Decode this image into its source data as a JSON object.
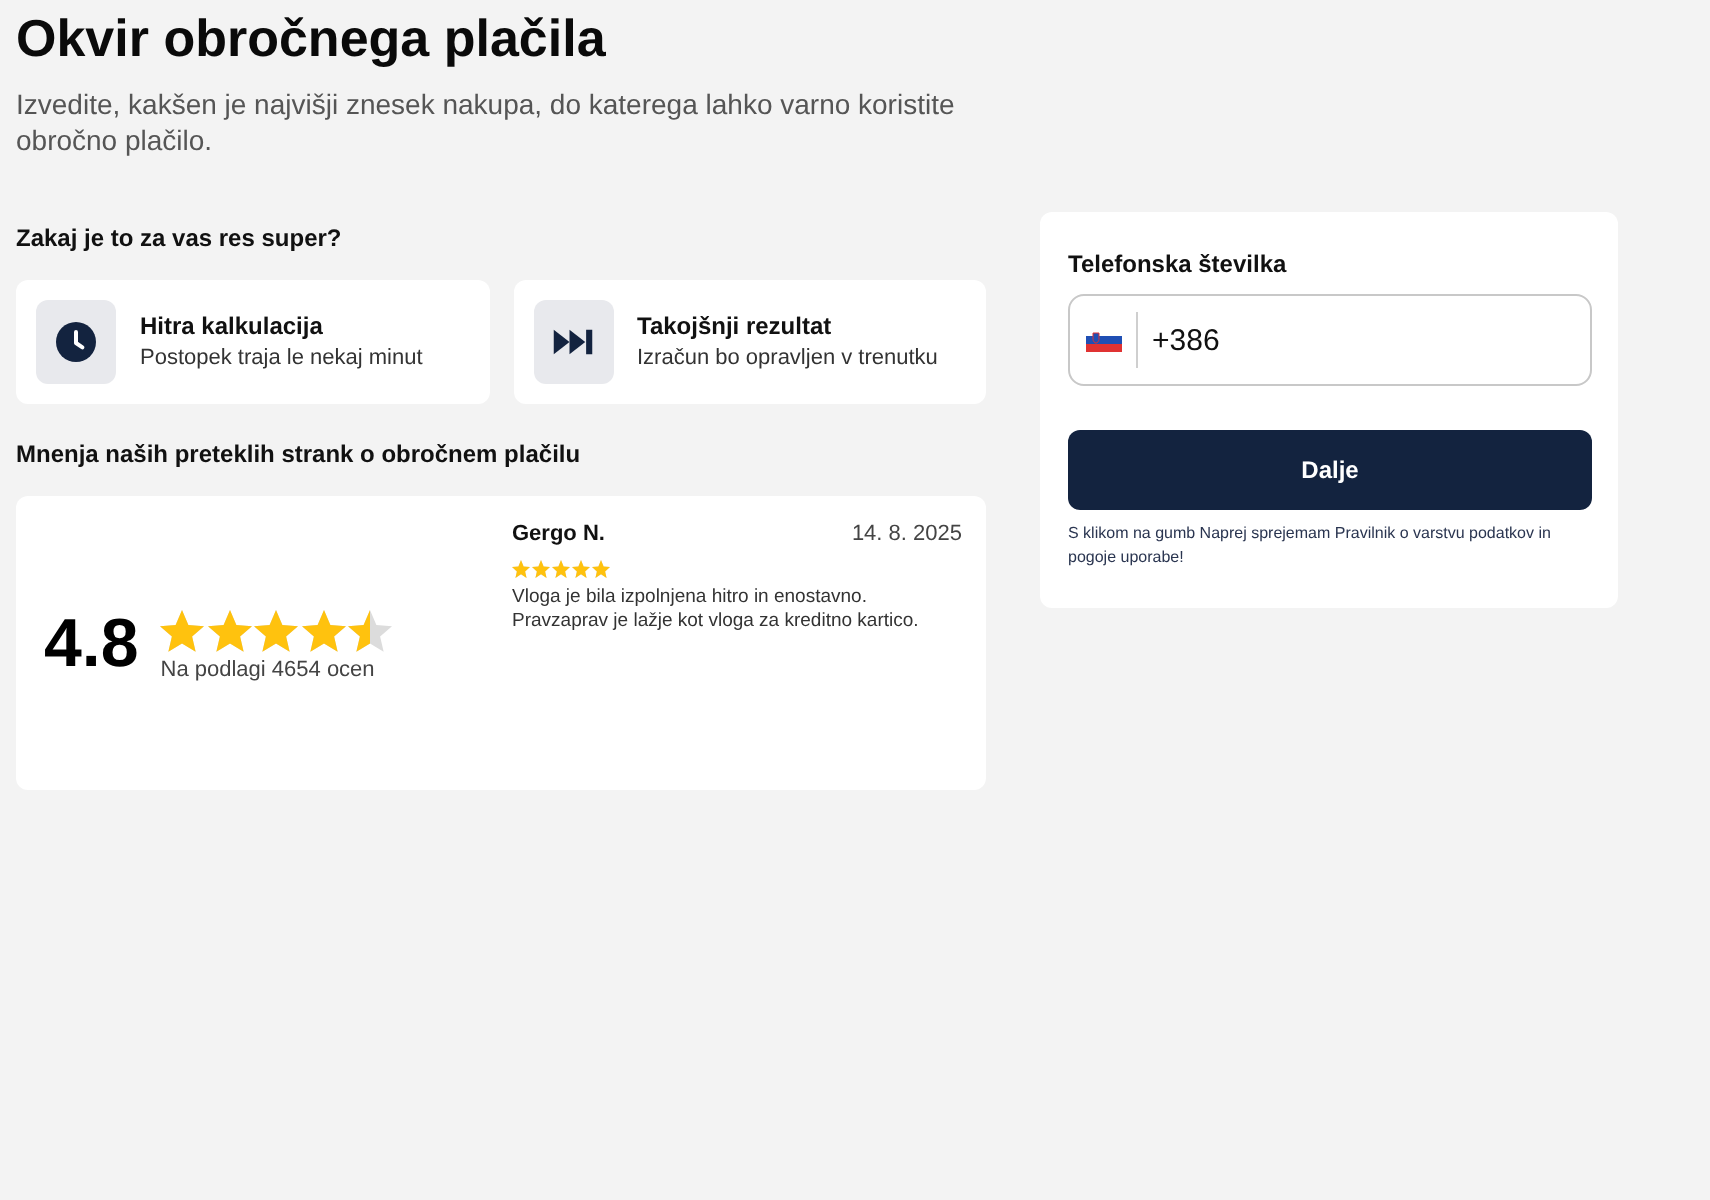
{
  "page": {
    "title": "Okvir obročnega plačila",
    "subtitle": "Izvedite, kakšen je najvišji znesek nakupa, do katerega lahko varno koristite obročno plačilo."
  },
  "benefits": {
    "heading": "Zakaj je to za vas res super?",
    "items": [
      {
        "kind": "clock",
        "title": "Hitra kalkulacija",
        "description": "Postopek traja le nekaj minut"
      },
      {
        "kind": "skip",
        "title": "Takojšnji rezultat",
        "description": "Izračun bo opravljen v trenutku"
      }
    ]
  },
  "reviews": {
    "heading": "Mnenja naših preteklih strank o obročnem plačilu",
    "rating": "4.8",
    "stars": 4.5,
    "count_text": "Na podlagi 4654 ocen",
    "items": [
      {
        "author": "Gergo N.",
        "date": "14. 8. 2025",
        "stars": 5,
        "text": "Vloga je bila izpolnjena hitro in enostavno. Pravzaprav je lažje kot vloga za kreditno kartico."
      }
    ]
  },
  "phone_form": {
    "label": "Telefonska številka",
    "value": "+386",
    "button": "Dalje",
    "terms": "S klikom na gumb Naprej sprejemam Pravilnik o varstvu podatkov in pogoje uporabe!"
  }
}
